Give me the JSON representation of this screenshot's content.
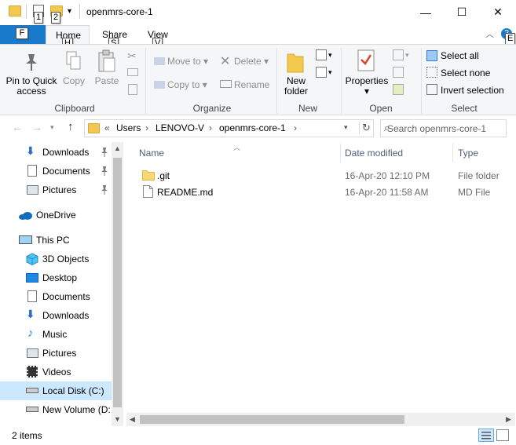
{
  "window": {
    "title": "openmrs-core-1",
    "qat_keytips": [
      "1",
      "2"
    ],
    "controls": [
      "—",
      "☐",
      "✕"
    ]
  },
  "tabs": {
    "file": {
      "label": "F"
    },
    "home": {
      "label": "Home",
      "keytip": "H"
    },
    "share": {
      "label": "Share",
      "keytip": "S"
    },
    "view": {
      "label": "View",
      "keytip": "V"
    },
    "help_keytip": "E"
  },
  "ribbon": {
    "clipboard": {
      "group_label": "Clipboard",
      "pin": "Pin to Quick access",
      "copy": "Copy",
      "paste": "Paste"
    },
    "organize": {
      "group_label": "Organize",
      "move_to": "Move to",
      "copy_to": "Copy to",
      "delete": "Delete",
      "rename": "Rename"
    },
    "new": {
      "group_label": "New",
      "new_folder": "New folder"
    },
    "open": {
      "group_label": "Open",
      "properties": "Properties"
    },
    "select": {
      "group_label": "Select",
      "select_all": "Select all",
      "select_none": "Select none",
      "invert": "Invert selection"
    }
  },
  "address": {
    "overflow": "«",
    "crumbs": [
      "Users",
      "LENOVO-V",
      "openmrs-core-1"
    ],
    "search_placeholder": "Search openmrs-core-1"
  },
  "nav": {
    "items": [
      {
        "label": "Downloads",
        "icon": "download-icon",
        "pinned": true
      },
      {
        "label": "Documents",
        "icon": "documents-icon",
        "pinned": true
      },
      {
        "label": "Pictures",
        "icon": "pictures-icon",
        "pinned": true
      },
      {
        "label": "OneDrive",
        "icon": "onedrive-icon"
      },
      {
        "label": "This PC",
        "icon": "pc-icon"
      },
      {
        "label": "3D Objects",
        "icon": "cube-icon"
      },
      {
        "label": "Desktop",
        "icon": "desktop-icon"
      },
      {
        "label": "Documents",
        "icon": "documents-icon"
      },
      {
        "label": "Downloads",
        "icon": "download-icon"
      },
      {
        "label": "Music",
        "icon": "music-icon"
      },
      {
        "label": "Pictures",
        "icon": "pictures-icon"
      },
      {
        "label": "Videos",
        "icon": "videos-icon"
      },
      {
        "label": "Local Disk (C:)",
        "icon": "drive-icon",
        "selected": true
      },
      {
        "label": "New Volume (D:",
        "icon": "drive-icon"
      }
    ]
  },
  "list": {
    "columns": [
      "Name",
      "Date modified",
      "Type"
    ],
    "rows": [
      {
        "name": ".git",
        "date": "16-Apr-20 12:10 PM",
        "type": "File folder",
        "icon": "folder-icon"
      },
      {
        "name": "README.md",
        "date": "16-Apr-20 11:58 AM",
        "type": "MD File",
        "icon": "file-icon"
      }
    ]
  },
  "status": {
    "count": "2 items"
  },
  "colors": {
    "accent": "#1979ca",
    "selected": "#cce8ff",
    "folder": "#f2c94c"
  }
}
